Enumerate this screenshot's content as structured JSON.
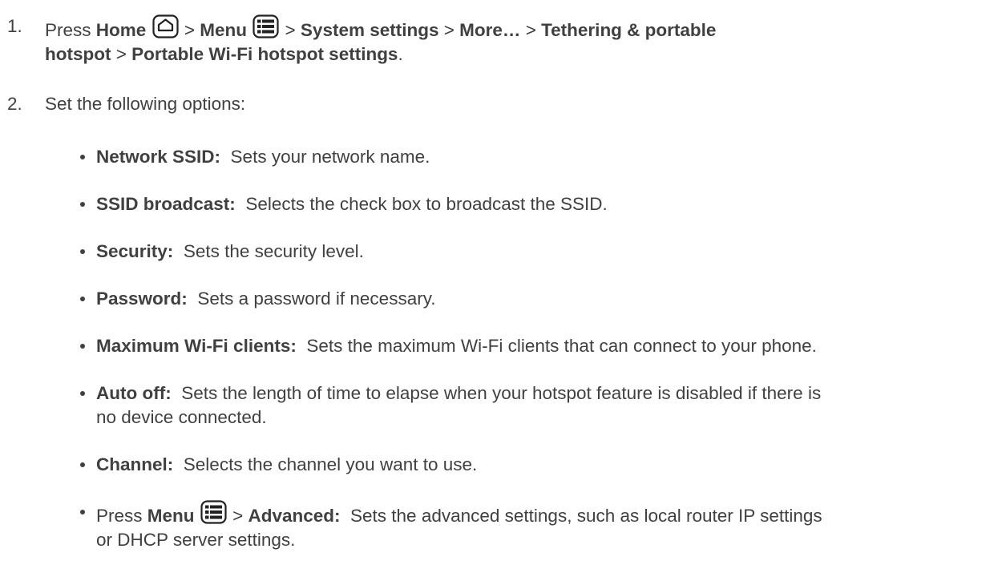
{
  "step1": {
    "number": "1.",
    "press": "Press",
    "home": "Home",
    "sep": ">",
    "menu": "Menu",
    "system_settings": "System settings",
    "more": "More…",
    "tethering_line1": "Tethering & portable",
    "hotspot_word": "hotspot",
    "portable_settings": "Portable Wi-Fi hotspot settings",
    "period": "."
  },
  "step2": {
    "number": "2.",
    "text": "Set the following options:"
  },
  "options": [
    {
      "label": "Network SSID:",
      "desc": "Sets your network name."
    },
    {
      "label": "SSID broadcast:",
      "desc": "Selects the check box to broadcast the SSID."
    },
    {
      "label": "Security:",
      "desc": "Sets the security level."
    },
    {
      "label": "Password:",
      "desc": "Sets a password if necessary."
    },
    {
      "label": "Maximum Wi-Fi clients:",
      "desc": "Sets the maximum Wi-Fi clients that can connect to your phone."
    },
    {
      "label": "Auto off:",
      "desc": "Sets the length of time to elapse when your hotspot feature is disabled if there is",
      "desc_line2": "no device connected."
    },
    {
      "label": "Channel:",
      "desc": "Selects the channel you want to use."
    }
  ],
  "advanced": {
    "press": "Press",
    "menu": "Menu",
    "sep": ">",
    "label": "Advanced:",
    "desc": "Sets the advanced settings, such as local router IP settings",
    "desc_line2": "or DHCP server settings."
  }
}
